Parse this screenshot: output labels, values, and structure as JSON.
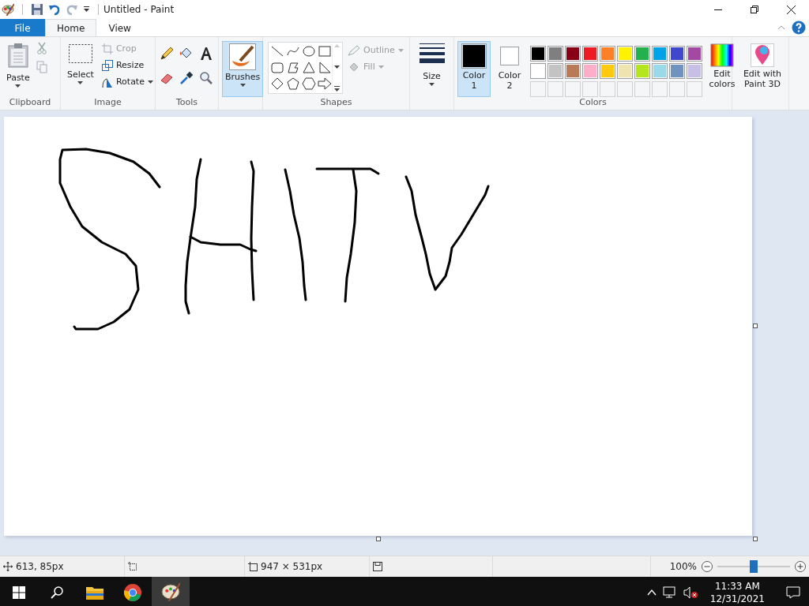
{
  "window": {
    "title": "Untitled - Paint"
  },
  "tabs": [
    {
      "label": "File",
      "kind": "file",
      "selected": false
    },
    {
      "label": "Home",
      "kind": "tab",
      "selected": true
    },
    {
      "label": "View",
      "kind": "tab",
      "selected": false
    }
  ],
  "clipboard": {
    "paste": "Paste",
    "label": "Clipboard"
  },
  "image": {
    "select": "Select",
    "crop": "Crop",
    "crop_disabled": true,
    "resize": "Resize",
    "rotate": "Rotate",
    "label": "Image"
  },
  "tools": {
    "label": "Tools"
  },
  "brushes": {
    "label": "Brushes",
    "selected": true
  },
  "shapes": {
    "outline": "Outline",
    "fill": "Fill",
    "disabled": true,
    "label": "Shapes"
  },
  "size": {
    "label": "Size"
  },
  "color1": {
    "label": "Color",
    "number": "1",
    "selected": true,
    "color": "#000000"
  },
  "color2": {
    "label": "Color",
    "number": "2",
    "selected": false,
    "color": "#ffffff"
  },
  "palette": [
    {
      "color": "#000000"
    },
    {
      "color": "#7f7f7f"
    },
    {
      "color": "#880015"
    },
    {
      "color": "#ed1c24"
    },
    {
      "color": "#ff7f27"
    },
    {
      "color": "#fff200"
    },
    {
      "color": "#22b14c"
    },
    {
      "color": "#00a2e8"
    },
    {
      "color": "#3f48cc"
    },
    {
      "color": "#a349a4"
    },
    {
      "color": "#ffffff"
    },
    {
      "color": "#c3c3c3"
    },
    {
      "color": "#b97a57"
    },
    {
      "color": "#ffaec9"
    },
    {
      "color": "#ffc90e"
    },
    {
      "color": "#efe4b0"
    },
    {
      "color": "#b5e61d"
    },
    {
      "color": "#99d9ea"
    },
    {
      "color": "#7092be"
    },
    {
      "color": "#c8bfe7"
    }
  ],
  "edit_colors": {
    "line1": "Edit",
    "line2": "colors"
  },
  "colors_label": "Colors",
  "paint3d": {
    "line1": "Edit with",
    "line2": "Paint 3D"
  },
  "status_bar": {
    "cursor": "613, 85px",
    "canvas_size": "947 × 531px",
    "zoom": "100%",
    "zoom_slider": {
      "level": 0.5
    }
  },
  "taskbar": {
    "apps": [
      {
        "kind": "explorer",
        "selected": false
      },
      {
        "kind": "chrome",
        "selected": false
      },
      {
        "kind": "paint",
        "selected": true
      }
    ],
    "time": "11:33 AM",
    "date": "12/31/2021"
  }
}
